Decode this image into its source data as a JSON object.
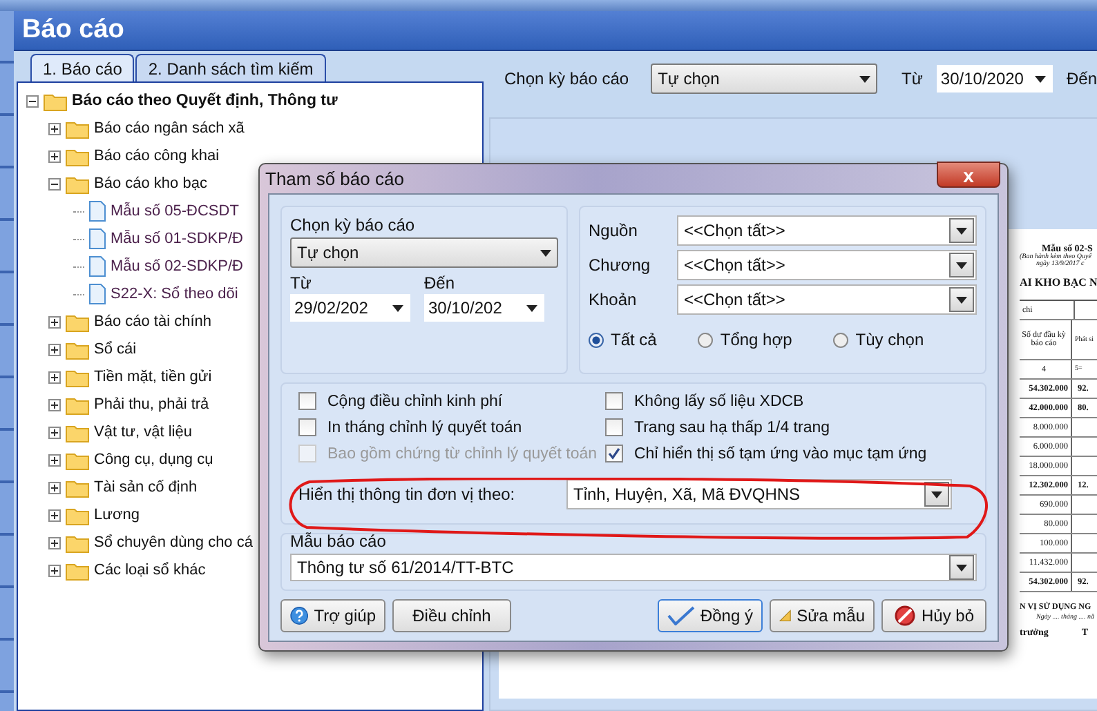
{
  "header": {
    "title": "Báo cáo"
  },
  "tabs": [
    {
      "label": "1. Báo cáo",
      "selected": true
    },
    {
      "label": "2. Danh sách tìm kiếm",
      "selected": false
    }
  ],
  "tree": [
    {
      "label": "Báo cáo theo Quyết định, Thông tư",
      "kind": "folder",
      "expanded": true,
      "children": [
        {
          "label": "Báo cáo ngân sách xã",
          "kind": "folder",
          "expanded": false
        },
        {
          "label": "Báo cáo công khai",
          "kind": "folder",
          "expanded": false
        },
        {
          "label": "Báo cáo kho bạc",
          "kind": "folder",
          "expanded": true,
          "children": [
            {
              "label": "Mẫu số 05-ĐCSDT",
              "kind": "report"
            },
            {
              "label": "Mẫu số 01-SDKP/Đ",
              "kind": "report"
            },
            {
              "label": "Mẫu số 02-SDKP/Đ",
              "kind": "report"
            },
            {
              "label": "S22-X: Sổ theo dõi",
              "kind": "report"
            }
          ]
        },
        {
          "label": "Báo cáo tài chính",
          "kind": "folder",
          "expanded": false
        },
        {
          "label": "Sổ cái",
          "kind": "folder",
          "expanded": false
        },
        {
          "label": "Tiền mặt, tiền gửi",
          "kind": "folder",
          "expanded": false
        },
        {
          "label": "Phải thu, phải trả",
          "kind": "folder",
          "expanded": false
        },
        {
          "label": "Vật tư, vật liệu",
          "kind": "folder",
          "expanded": false
        },
        {
          "label": "Công cụ, dụng cụ",
          "kind": "folder",
          "expanded": false
        },
        {
          "label": "Tài sản cố định",
          "kind": "folder",
          "expanded": false
        },
        {
          "label": "Lương",
          "kind": "folder",
          "expanded": false
        },
        {
          "label": "Sổ chuyên dùng cho cá",
          "kind": "folder",
          "expanded": false
        },
        {
          "label": "Các loại sổ khác",
          "kind": "folder",
          "expanded": false
        }
      ]
    }
  ],
  "toolbar": {
    "period_label": "Chọn kỳ báo cáo",
    "period_value": "Tự chọn",
    "from_label": "Từ",
    "from_value": "30/10/2020",
    "to_label": "Đến"
  },
  "preview_document": {
    "form_no": "Mẫu số 02-S",
    "issued": "(Ban hành kèm theo Quyế",
    "issued_date": "ngày 13/9/2017 c",
    "heading": "AI KHO BẠC N",
    "table_header": "chi",
    "column_headings": [
      "Số dư đầu kỳ báo cáo",
      "Phát si"
    ],
    "column_numbers": [
      "4",
      "5="
    ],
    "rows": [
      {
        "cells": [
          "54.302.000",
          "92."
        ],
        "bold": true
      },
      {
        "cells": [
          "42.000.000",
          "80."
        ],
        "bold": true
      },
      {
        "cells": [
          "8.000.000",
          ""
        ],
        "bold": false
      },
      {
        "cells": [
          "6.000.000",
          ""
        ],
        "bold": false
      },
      {
        "cells": [
          "18.000.000",
          ""
        ],
        "bold": false
      },
      {
        "cells": [
          "12.302.000",
          "12."
        ],
        "bold": true
      },
      {
        "cells": [
          "690.000",
          ""
        ],
        "bold": false
      },
      {
        "cells": [
          "80.000",
          ""
        ],
        "bold": false
      },
      {
        "cells": [
          "100.000",
          ""
        ],
        "bold": false
      },
      {
        "cells": [
          "11.432.000",
          ""
        ],
        "bold": false
      },
      {
        "cells": [
          "54.302.000",
          "92."
        ],
        "bold": true
      }
    ],
    "signature_unit": "N VỊ SỬ DỤNG NG",
    "signature_date": "Ngày .... tháng .... nă",
    "signer_left": "trưởng",
    "signer_right": "T"
  },
  "dialog": {
    "title": "Tham số báo cáo",
    "close": "x",
    "period_label": "Chọn kỳ báo cáo",
    "period_value": "Tự chọn",
    "from_label": "Từ",
    "from_value": "29/02/202",
    "to_label": "Đến",
    "to_value": "30/10/202",
    "filters": [
      {
        "label": "Nguồn",
        "value": "<<Chọn tất>>"
      },
      {
        "label": "Chương",
        "value": "<<Chọn tất>>"
      },
      {
        "label": "Khoản",
        "value": "<<Chọn tất>>"
      }
    ],
    "radios": [
      {
        "label": "Tất cả",
        "selected": true
      },
      {
        "label": "Tổng hợp",
        "selected": false
      },
      {
        "label": "Tùy chọn",
        "selected": false
      }
    ],
    "options": [
      {
        "label": "Cộng điều chỉnh kinh phí",
        "checked": false,
        "disabled": false
      },
      {
        "label": "Không lấy số liệu XDCB",
        "checked": false,
        "disabled": false
      },
      {
        "label": "In tháng chỉnh lý quyết toán",
        "checked": false,
        "disabled": false
      },
      {
        "label": "Trang sau hạ thấp 1/4 trang",
        "checked": false,
        "disabled": false
      },
      {
        "label": "Bao gồm chứng từ chỉnh lý quyết toán",
        "checked": false,
        "disabled": true
      },
      {
        "label": "Chỉ hiển thị số tạm ứng vào mục tạm ứng",
        "checked": true,
        "disabled": false
      }
    ],
    "unit_display_label": "Hiển thị thông tin đơn vị theo:",
    "unit_display_value": "Tỉnh, Huyện, Xã, Mã ĐVQHNS",
    "template_label": "Mẫu báo cáo",
    "template_value": "Thông tư số 61/2014/TT-BTC",
    "buttons": [
      {
        "label": "Trợ giúp",
        "kind": "help"
      },
      {
        "label": "Điều chỉnh",
        "kind": "plain"
      },
      {
        "label": "Đồng ý",
        "kind": "ok"
      },
      {
        "label": "Sửa mẫu",
        "kind": "edit"
      },
      {
        "label": "Hủy bỏ",
        "kind": "cancel"
      }
    ]
  }
}
